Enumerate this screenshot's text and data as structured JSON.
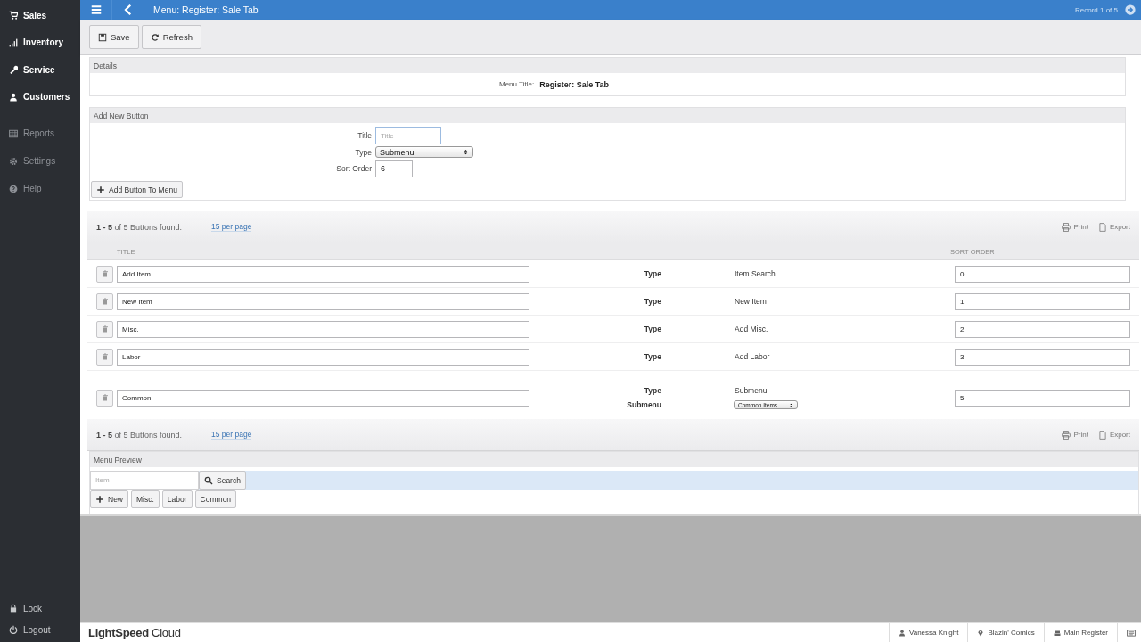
{
  "sidebar": {
    "primary": [
      {
        "label": "Sales"
      },
      {
        "label": "Inventory"
      },
      {
        "label": "Service"
      },
      {
        "label": "Customers"
      }
    ],
    "secondary": [
      {
        "label": "Reports"
      },
      {
        "label": "Settings"
      },
      {
        "label": "Help"
      }
    ],
    "bottom": [
      {
        "label": "Lock"
      },
      {
        "label": "Logout"
      }
    ]
  },
  "header": {
    "title": "Menu: Register: Sale Tab",
    "record": "Record 1 of 5"
  },
  "toolbar": [
    {
      "label": "Save"
    },
    {
      "label": "Refresh"
    }
  ],
  "details": {
    "heading": "Details",
    "label": "Menu Title:",
    "value": "Register: Sale Tab"
  },
  "add_new": {
    "heading": "Add New Button",
    "title_label": "Title",
    "title_placeholder": "Title",
    "type_label": "Type",
    "type_value": "Submenu",
    "sort_label": "Sort Order",
    "sort_value": "6",
    "button": "Add Button To Menu"
  },
  "list": {
    "top_bar": {
      "count_range": "1 - 5",
      "count_text": "of 5 Buttons found.",
      "per_page": "15 per page",
      "print": "Print",
      "export": "Export"
    },
    "bottom_bar": {
      "count_range": "1 - 5",
      "count_text": "of 5 Buttons found.",
      "per_page": "15 per page",
      "print": "Print",
      "export": "Export"
    },
    "columns": [
      "TITLE",
      "SORT ORDER"
    ],
    "rows": [
      {
        "kind": "plain",
        "title": "Add Item",
        "type_label": "Type",
        "type_value": "Item Search",
        "sort": "0"
      },
      {
        "kind": "plain",
        "title": "New Item",
        "type_label": "Type",
        "type_value": "New Item",
        "sort": "1"
      },
      {
        "kind": "plain",
        "title": "Misc.",
        "type_label": "Type",
        "type_value": "Add Misc.",
        "sort": "2"
      },
      {
        "kind": "plain",
        "title": "Labor",
        "type_label": "Type",
        "type_value": "Add Labor",
        "sort": "3"
      },
      {
        "kind": "submenu",
        "title": "Common",
        "type_label": "Type",
        "type_value": "Submenu",
        "submenu_label": "Submenu",
        "submenu_value": "Common Items",
        "sort": "5"
      }
    ]
  },
  "preview": {
    "heading": "Menu Preview",
    "search_placeholder": "Item",
    "search_button": "Search",
    "buttons": [
      {
        "kind": "add",
        "label": "New"
      },
      {
        "kind": "plain",
        "label": "Misc."
      },
      {
        "kind": "plain",
        "label": "Labor"
      },
      {
        "kind": "plain",
        "label": "Common"
      }
    ]
  },
  "footer": {
    "logo_light": "LightSpeed",
    "logo_rest": "Cloud",
    "user": "Vanessa Knight",
    "shop": "Blazin' Comics",
    "register": "Main Register"
  }
}
